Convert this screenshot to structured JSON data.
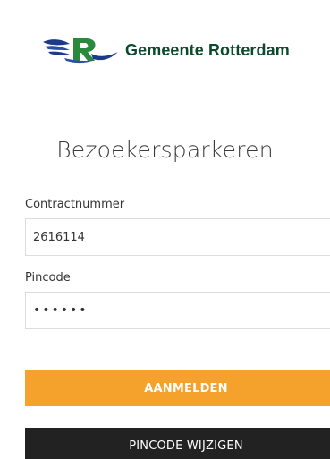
{
  "header": {
    "brand_name": "Gemeente Rotterdam",
    "logo_icon": "gemeente-rotterdam-logo-icon",
    "brand_color": "#0b4a2d"
  },
  "page": {
    "title": "Bezoekersparkeren"
  },
  "form": {
    "contract_label": "Contractnummer",
    "contract_value": "2616114",
    "pin_label": "Pincode",
    "pin_value": "••••••"
  },
  "buttons": {
    "login_label": "AANMELDEN",
    "login_color": "#f4a22b",
    "change_pin_label": "PINCODE WIJZIGEN",
    "change_pin_color": "#222222"
  }
}
